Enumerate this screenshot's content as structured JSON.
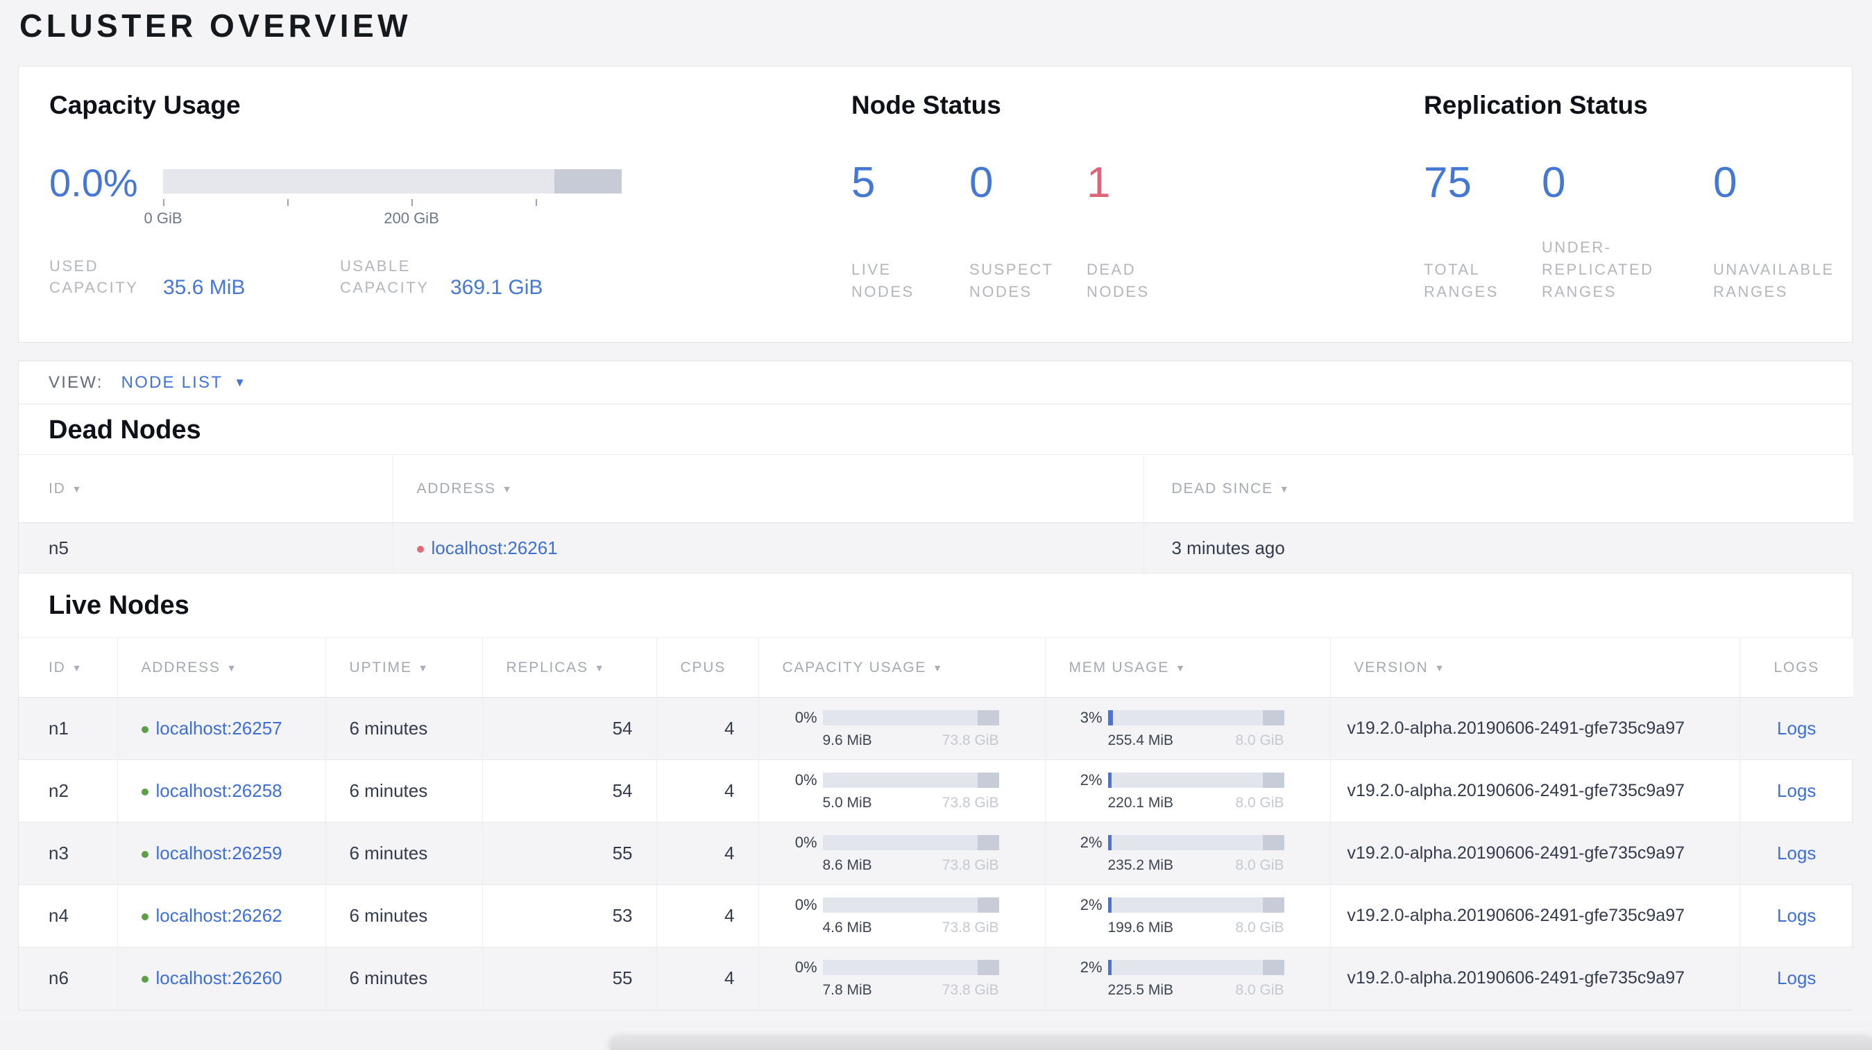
{
  "page_title": "CLUSTER OVERVIEW",
  "summary": {
    "capacity": {
      "title": "Capacity Usage",
      "percent": "0.0%",
      "fill_pct": 0,
      "ticks": [
        "0 GiB",
        "200 GiB"
      ],
      "used_label": "USED\nCAPACITY",
      "used_value": "35.6 MiB",
      "usable_label": "USABLE\nCAPACITY",
      "usable_value": "369.1 GiB"
    },
    "nodes": {
      "title": "Node Status",
      "stats": [
        {
          "value": "5",
          "label": "LIVE\nNODES"
        },
        {
          "value": "0",
          "label": "SUSPECT\nNODES"
        },
        {
          "value": "1",
          "label": "DEAD\nNODES"
        }
      ]
    },
    "replication": {
      "title": "Replication Status",
      "stats": [
        {
          "value": "75",
          "label": "TOTAL\nRANGES"
        },
        {
          "value": "0",
          "label": "UNDER-\nREPLICATED\nRANGES"
        },
        {
          "value": "0",
          "label": "UNAVAILABLE\nRANGES"
        }
      ]
    }
  },
  "view_bar": {
    "label": "VIEW:",
    "selected": "NODE LIST"
  },
  "dead_nodes": {
    "title": "Dead Nodes",
    "columns": [
      "ID",
      "ADDRESS",
      "DEAD SINCE"
    ],
    "rows": [
      {
        "id": "n5",
        "address": "localhost:26261",
        "dead_since": "3 minutes ago"
      }
    ]
  },
  "live_nodes": {
    "title": "Live Nodes",
    "columns": [
      "ID",
      "ADDRESS",
      "UPTIME",
      "REPLICAS",
      "CPUS",
      "CAPACITY USAGE",
      "MEM USAGE",
      "VERSION",
      "LOGS"
    ],
    "rows": [
      {
        "id": "n1",
        "address": "localhost:26257",
        "uptime": "6 minutes",
        "replicas": "54",
        "cpus": "4",
        "cap_pct": 0,
        "cap_pct_label": "0%",
        "cap_used": "9.6 MiB",
        "cap_total": "73.8 GiB",
        "mem_pct": 3,
        "mem_pct_label": "3%",
        "mem_used": "255.4 MiB",
        "mem_total": "8.0 GiB",
        "version": "v19.2.0-alpha.20190606-2491-gfe735c9a97",
        "logs_label": "Logs"
      },
      {
        "id": "n2",
        "address": "localhost:26258",
        "uptime": "6 minutes",
        "replicas": "54",
        "cpus": "4",
        "cap_pct": 0,
        "cap_pct_label": "0%",
        "cap_used": "5.0 MiB",
        "cap_total": "73.8 GiB",
        "mem_pct": 2,
        "mem_pct_label": "2%",
        "mem_used": "220.1 MiB",
        "mem_total": "8.0 GiB",
        "version": "v19.2.0-alpha.20190606-2491-gfe735c9a97",
        "logs_label": "Logs"
      },
      {
        "id": "n3",
        "address": "localhost:26259",
        "uptime": "6 minutes",
        "replicas": "55",
        "cpus": "4",
        "cap_pct": 0,
        "cap_pct_label": "0%",
        "cap_used": "8.6 MiB",
        "cap_total": "73.8 GiB",
        "mem_pct": 2,
        "mem_pct_label": "2%",
        "mem_used": "235.2 MiB",
        "mem_total": "8.0 GiB",
        "version": "v19.2.0-alpha.20190606-2491-gfe735c9a97",
        "logs_label": "Logs"
      },
      {
        "id": "n4",
        "address": "localhost:26262",
        "uptime": "6 minutes",
        "replicas": "53",
        "cpus": "4",
        "cap_pct": 0,
        "cap_pct_label": "0%",
        "cap_used": "4.6 MiB",
        "cap_total": "73.8 GiB",
        "mem_pct": 2,
        "mem_pct_label": "2%",
        "mem_used": "199.6 MiB",
        "mem_total": "8.0 GiB",
        "version": "v19.2.0-alpha.20190606-2491-gfe735c9a97",
        "logs_label": "Logs"
      },
      {
        "id": "n6",
        "address": "localhost:26260",
        "uptime": "6 minutes",
        "replicas": "55",
        "cpus": "4",
        "cap_pct": 0,
        "cap_pct_label": "0%",
        "cap_used": "7.8 MiB",
        "cap_total": "73.8 GiB",
        "mem_pct": 2,
        "mem_pct_label": "2%",
        "mem_used": "225.5 MiB",
        "mem_total": "8.0 GiB",
        "version": "v19.2.0-alpha.20190606-2491-gfe735c9a97",
        "logs_label": "Logs"
      }
    ]
  }
}
